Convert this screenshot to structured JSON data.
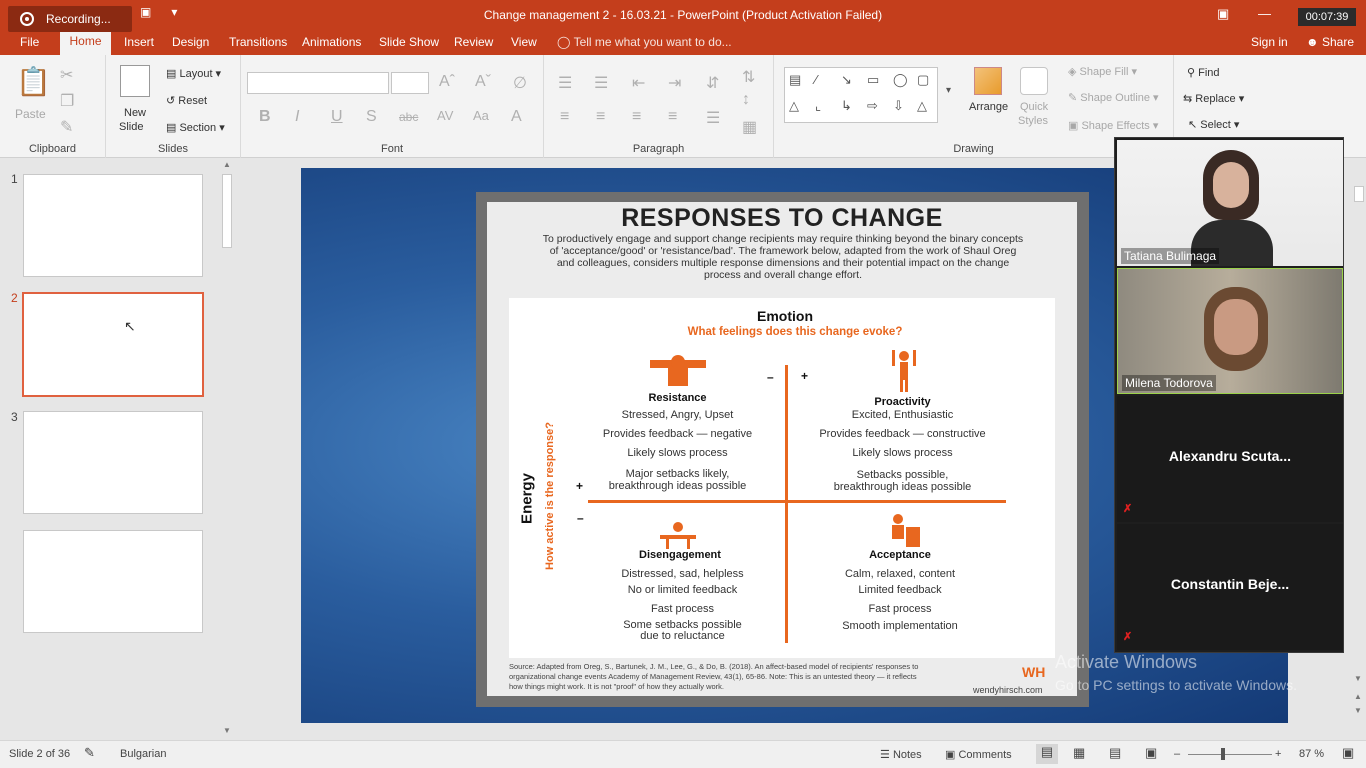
{
  "titlebar": {
    "recording_label": "Recording...",
    "title": "Change management 2 - 16.03.21 - PowerPoint (Product Activation Failed)",
    "timer": "00:07:39"
  },
  "tabs": {
    "file": "File",
    "home": "Home",
    "insert": "Insert",
    "design": "Design",
    "transitions": "Transitions",
    "animations": "Animations",
    "slide_show": "Slide Show",
    "review": "Review",
    "view": "View",
    "tell_me": "Tell me what you want to do...",
    "sign_in": "Sign in",
    "share": "Share"
  },
  "ribbon": {
    "clipboard": {
      "label": "Clipboard",
      "paste": "Paste"
    },
    "slides": {
      "label": "Slides",
      "new_slide": "New",
      "new_slide2": "Slide",
      "layout": "Layout",
      "reset": "Reset",
      "section": "Section"
    },
    "font": {
      "label": "Font"
    },
    "paragraph": {
      "label": "Paragraph"
    },
    "drawing": {
      "label": "Drawing",
      "arrange": "Arrange",
      "quick_styles": "Quick",
      "quick_styles2": "Styles",
      "shape_fill": "Shape Fill",
      "shape_outline": "Shape Outline",
      "shape_effects": "Shape Effects"
    },
    "editing": {
      "find": "Find",
      "replace": "Replace",
      "select": "Select"
    }
  },
  "thumbnails": [
    {
      "num": "1"
    },
    {
      "num": "2"
    },
    {
      "num": "3"
    },
    {
      "num": ""
    }
  ],
  "slide": {
    "title": "RESPONSES TO CHANGE",
    "intro": "To productively engage and support change recipients may require thinking beyond the binary concepts of 'acceptance/good' or 'resistance/bad'. The framework below, adapted from the work of Shaul Oreg and colleagues, considers multiple response dimensions and their potential impact on the change process and overall change effort.",
    "emotion": "Emotion",
    "emotion_sub": "What feelings does this change evoke?",
    "energy": "Energy",
    "energy_sub": "How active is the response?",
    "minus": "–",
    "plus": "+",
    "resistance": {
      "title": "Resistance",
      "l1": "Stressed, Angry, Upset",
      "l2": "Provides feedback — negative",
      "l3": "Likely slows process",
      "l4a": "Major setbacks likely,",
      "l4b": "breakthrough ideas possible"
    },
    "proactivity": {
      "title": "Proactivity",
      "l1": "Excited, Enthusiastic",
      "l2": "Provides feedback — constructive",
      "l3": "Likely slows process",
      "l4a": "Setbacks possible,",
      "l4b": "breakthrough ideas possible"
    },
    "disengagement": {
      "title": "Disengagement",
      "l1": "Distressed, sad, helpless",
      "l2": "No or limited feedback",
      "l3": "Fast process",
      "l4a": "Some setbacks possible",
      "l4b": "due to reluctance"
    },
    "acceptance": {
      "title": "Acceptance",
      "l1": "Calm, relaxed, content",
      "l2": "Limited feedback",
      "l3": "Fast process",
      "l4": "Smooth implementation"
    },
    "source": "Source: Adapted from Oreg, S., Bartunek, J. M., Lee, G., & Do, B. (2018). An affect-based model of recipients' responses to organizational change events Academy of Management Review, 43(1), 65-86. Note: This is an untested theory — it reflects how things might work. It is not \"proof\" of how they actually work.",
    "brand": "wendyhirsch.com",
    "brand_logo": "WH"
  },
  "watermark": {
    "line1": "Activate Windows",
    "line2": "Go to PC settings to activate Windows."
  },
  "participants": [
    {
      "name": "Tatiana Bulimaga"
    },
    {
      "name": "Milena Todorova"
    },
    {
      "name": "Alexandru  Scuta..."
    },
    {
      "name": "Constantin  Beje..."
    }
  ],
  "status": {
    "slide_count": "Slide 2 of 36",
    "language": "Bulgarian",
    "notes": "Notes",
    "comments": "Comments",
    "zoom": "87 %"
  },
  "colors": {
    "accent": "#c43e1c",
    "orange": "#e8671f"
  }
}
